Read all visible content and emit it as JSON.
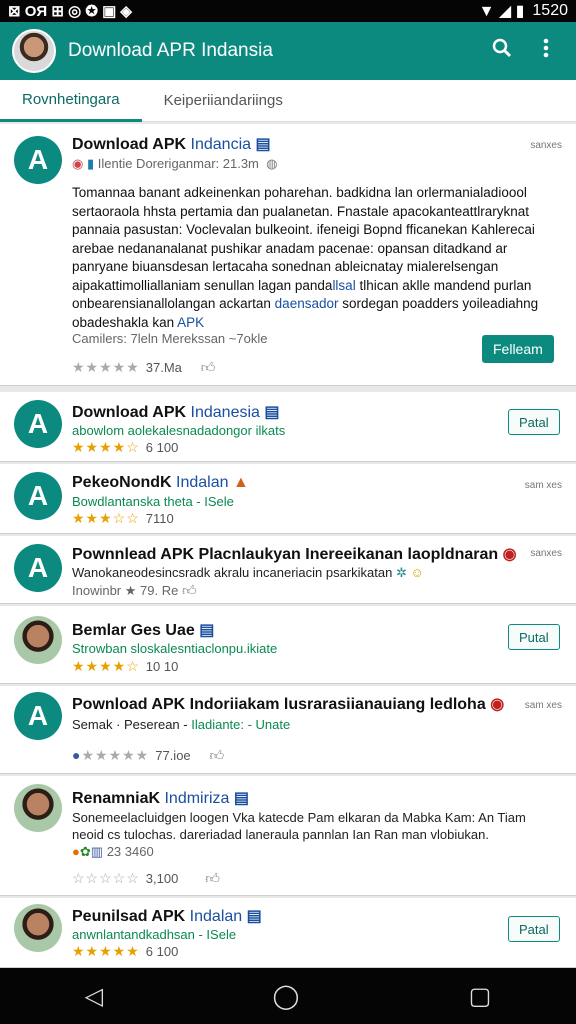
{
  "status": {
    "left": "⊠ OЯ ⊞ ◎ ✪ ▣ ◈",
    "time": "1520",
    "signal": "▼ ◢ ▮"
  },
  "appbar": {
    "title": "Download APR Indansia",
    "search_icon": "search-icon",
    "more_icon": "more-vert-icon"
  },
  "tabs": [
    {
      "label": "Rovnhetingara"
    },
    {
      "label": "Keiperiiandariings"
    }
  ],
  "featured": {
    "title": "Download APK",
    "title_accent": "Indancia",
    "meta": "Ilentie Doreriganmar: 21.3m",
    "more": "sanxes",
    "desc1": "Tomannaa banant adkeinenkan poharehan. badkidna lan orlermanialadioool sertaoraola hhsta pertamia dan pualanetan. Fnastale apacokanteattlraryknat pannaia pasustan: Voclevalan bulkeoint.",
    "desc2": "ifeneigi Bopnd fficanekan Kahlerecai arebae nedananalanat pushikar anadam pacenae: opansan ditadkand ar panryane biuansdesan lertacaha sonednan ableicnatay mialerelsengan aipakattimolliallaniam senullan lagan panda",
    "desc2_hl": "llsal",
    "desc3": "tlhican aklle mandend purlan onbearensianallolangan ackartan",
    "desc3_hl": "daensador",
    "desc4": "sordegan poadders yoileadiahng obadeshakla kan",
    "desc4_hl": "APK",
    "footer": "Camilers: 7leln Merekssan ~7okle",
    "rating": "★★★★★",
    "count": "37.Ma",
    "button": "Felleam"
  },
  "items": [
    {
      "title": "Download APK",
      "accent": "Indanesia",
      "sub": "abowlom aolekalesnadadongor ilkats",
      "stars": "★★★★☆",
      "count": "6 100",
      "button": "Patal"
    },
    {
      "title": "PekeoNondK",
      "accent": "Indalan",
      "sub": "Bowdlantanska theta - ISele",
      "stars": "★★★☆☆",
      "count": "7110",
      "more": "sam xes"
    },
    {
      "title": "Pownnlead APK Placnlaukyan Inereeikanan laopldnaran",
      "sub": "Wanokaneodesincsradk akralu incaneriacin psarkikatan",
      "meta": "Inowinbr ★ 79. Re",
      "more": "sanxes"
    },
    {
      "title": "Bemlar Ges Uae",
      "sub": "Strowban sloskalesntiaclonpu.ikiate",
      "stars": "★★★★☆",
      "count": "10 10",
      "button": "Putal"
    },
    {
      "title": "Pownload APK Indoriiakam lusrarasiianauiang ledloha",
      "sub": "Semak · Peserean -",
      "sub_hl": "Iladiante: - Unate",
      "stars": "★★★★★",
      "count": "77.ioe",
      "more": "sam xes"
    },
    {
      "title": "RenamniaK",
      "accent": "Indmiriza",
      "sub": "Sonemeelacluidgen loogen Vka katecde Pam elkaran da Mabka Kam: An Tiam neoid cs tulochas. dareriadad laneraula pannlan Ian Ran man vlobiukan.",
      "meta": "23 3460",
      "stars": "☆☆☆☆☆",
      "count": "3,100"
    },
    {
      "title": "Peunilsad APK",
      "accent": "Indalan",
      "sub": "anwnlantandkadhsan - ISele",
      "stars": "★★★★★",
      "count": "6 100",
      "button": "Patal"
    }
  ],
  "nav": {
    "back": "◁",
    "home": "◯",
    "recent": "▢"
  }
}
